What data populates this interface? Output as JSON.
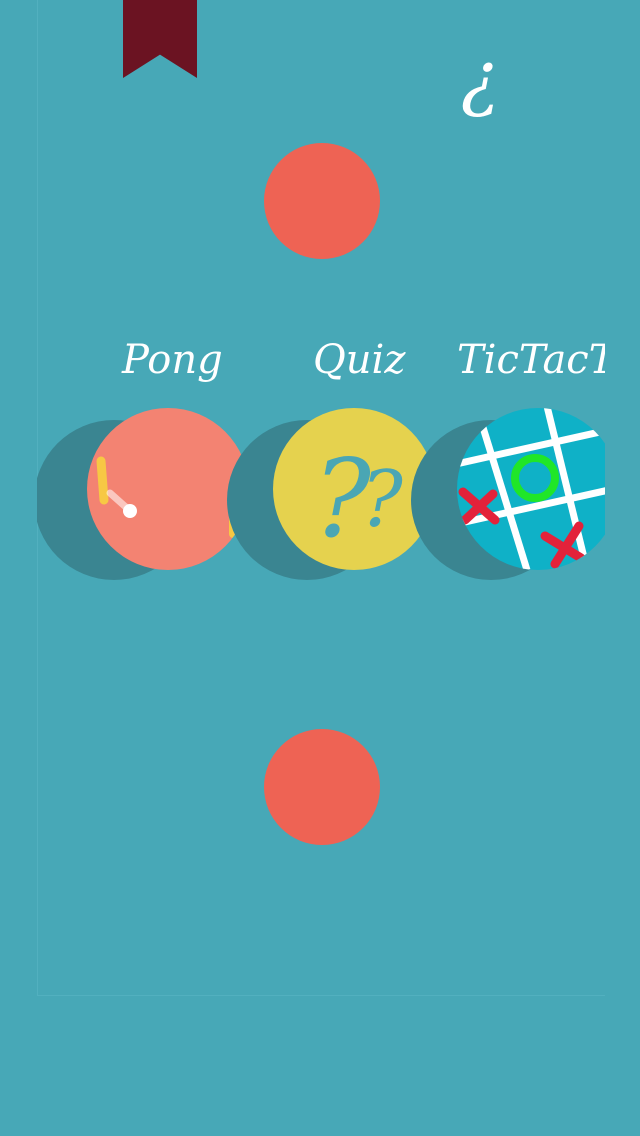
{
  "header": {
    "bookmark_icon": "bookmark-icon",
    "help_glyph": "¿"
  },
  "navigation": {
    "up_button": "circle-button",
    "down_button": "circle-button"
  },
  "games": [
    {
      "label": "Pong",
      "icon": "pong-icon",
      "color": "#f38372"
    },
    {
      "label": "Quiz",
      "icon": "question-marks-icon",
      "color": "#e5d24e"
    },
    {
      "label": "TicTacToe",
      "icon": "tictactoe-icon",
      "color": "#0fb1c7"
    }
  ],
  "colors": {
    "background": "#47a8b7",
    "accent": "#ee6354",
    "bookmark": "#6b1322",
    "shadow": "#3a8591"
  }
}
